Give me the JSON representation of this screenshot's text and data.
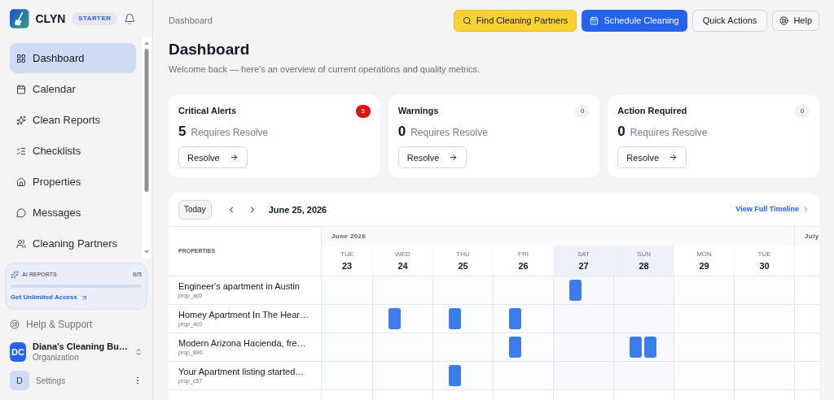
{
  "sidebar": {
    "brand": "CLYN",
    "plan": "STARTER",
    "nav": [
      {
        "label": "Dashboard",
        "selected": true
      },
      {
        "label": "Calendar",
        "selected": false
      },
      {
        "label": "Clean Reports",
        "selected": false
      },
      {
        "label": "Checklists",
        "selected": false
      },
      {
        "label": "Properties",
        "selected": false
      },
      {
        "label": "Messages",
        "selected": false
      },
      {
        "label": "Cleaning Partners",
        "selected": false
      }
    ],
    "ai_reports": {
      "title": "AI REPORTS",
      "count": "0/5",
      "level": 0,
      "link": "Get Unlimited Access"
    },
    "help": "Help & Support",
    "org": {
      "initials": "DC",
      "name": "Diana's Cleaning Bu…",
      "role": "Organization"
    },
    "user": {
      "initial": "D",
      "label": "Settings"
    }
  },
  "header": {
    "breadcrumb": "Dashboard",
    "buttons": [
      {
        "label": "Find Cleaning Partners",
        "kind": "search"
      },
      {
        "label": "Schedule Cleaning",
        "kind": "schedule"
      },
      {
        "label": "Quick Actions",
        "kind": "plain"
      },
      {
        "label": "Help",
        "kind": "help"
      }
    ]
  },
  "page": {
    "title": "Dashboard",
    "subtitle": "Welcome back — here's an overview of current operations and quality metrics."
  },
  "alerts": [
    {
      "title": "Critical Alerts",
      "badge": "5",
      "urgent": true,
      "count": "5",
      "caption": "Requires Resolve",
      "button": "Resolve"
    },
    {
      "title": "Warnings",
      "badge": "0",
      "urgent": false,
      "count": "0",
      "caption": "Requires Resolve",
      "button": "Resolve"
    },
    {
      "title": "Action Required",
      "badge": "0",
      "urgent": false,
      "count": "0",
      "caption": "Requires Resolve",
      "button": "Resolve"
    }
  ],
  "timeline": {
    "today": "Today",
    "date": "June 25, 2026",
    "link": "View Full Timeline",
    "properties_heading": "PROPERTIES",
    "month": "June 2026",
    "next_month": "July",
    "days": [
      {
        "weekday": "TUE",
        "date": "23",
        "weekend": false
      },
      {
        "weekday": "WED",
        "date": "24",
        "weekend": false
      },
      {
        "weekday": "THU",
        "date": "25",
        "weekend": false
      },
      {
        "weekday": "FRI",
        "date": "26",
        "weekend": false
      },
      {
        "weekday": "SAT",
        "date": "27",
        "weekend": true
      },
      {
        "weekday": "SUN",
        "date": "28",
        "weekend": true
      },
      {
        "weekday": "MON",
        "date": "29",
        "weekend": false
      },
      {
        "weekday": "TUE",
        "date": "30",
        "weekend": false
      }
    ],
    "rows": [
      {
        "name": "Engineer's apartment in Austin",
        "id": "prop_ac0",
        "days": [
          {
            "booked": false
          },
          {
            "booked": false
          },
          {
            "booked": false
          },
          {
            "booked": false
          },
          {
            "booked": true,
            "double": false
          },
          {
            "booked": false
          },
          {
            "booked": false
          },
          {
            "booked": false
          }
        ]
      },
      {
        "name": "Homey Apartment In The Hear…",
        "id": "prop_4c0",
        "days": [
          {
            "booked": false
          },
          {
            "booked": true,
            "double": false
          },
          {
            "booked": true,
            "double": false
          },
          {
            "booked": true,
            "double": false
          },
          {
            "booked": false
          },
          {
            "booked": false
          },
          {
            "booked": false
          },
          {
            "booked": false
          }
        ]
      },
      {
        "name": "Modern Arizona Hacienda, fre…",
        "id": "prop_890",
        "days": [
          {
            "booked": false
          },
          {
            "booked": false
          },
          {
            "booked": false
          },
          {
            "booked": true,
            "double": false
          },
          {
            "booked": false
          },
          {
            "booked": true,
            "double": true
          },
          {
            "booked": false
          },
          {
            "booked": false
          }
        ]
      },
      {
        "name": "Your Apartment listing started…",
        "id": "prop_c57",
        "days": [
          {
            "booked": false
          },
          {
            "booked": false
          },
          {
            "booked": true,
            "double": false
          },
          {
            "booked": false
          },
          {
            "booked": false
          },
          {
            "booked": false
          },
          {
            "booked": false
          },
          {
            "booked": false
          }
        ]
      }
    ]
  }
}
